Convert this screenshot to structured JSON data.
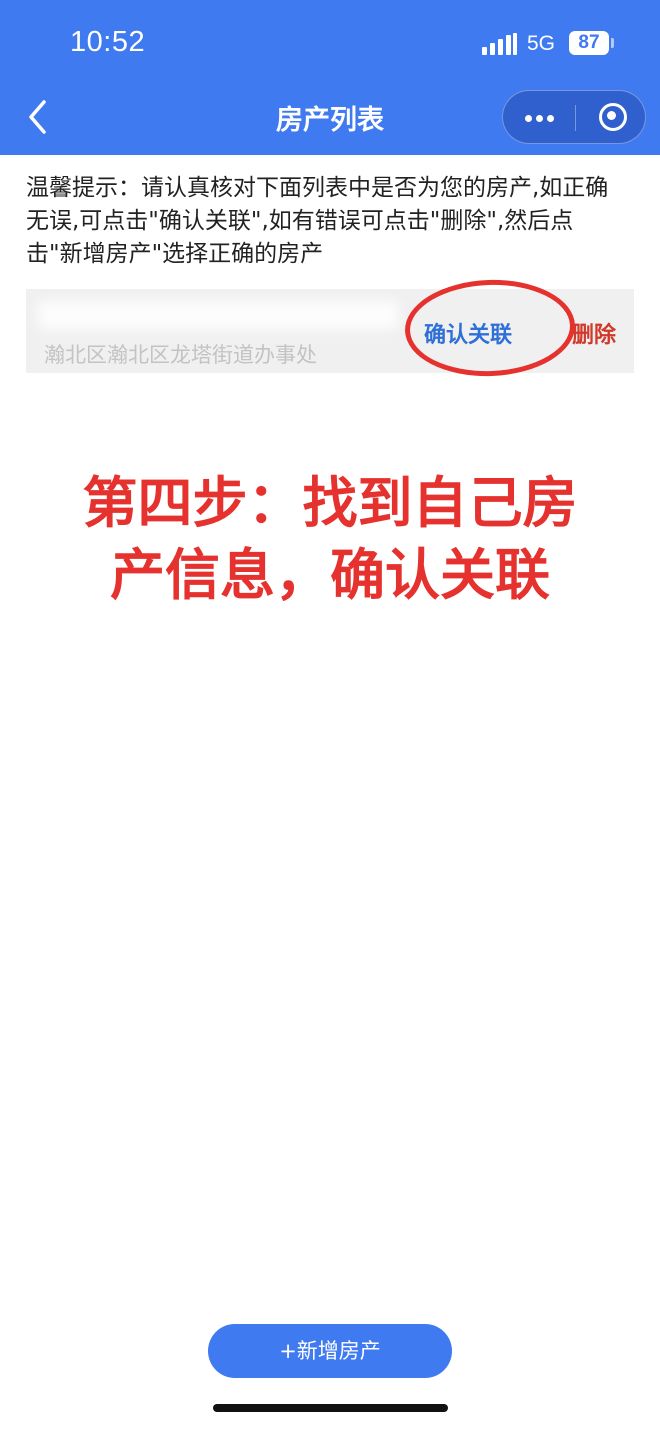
{
  "status_bar": {
    "time": "10:52",
    "network": "5G",
    "battery": "87"
  },
  "nav": {
    "title": "房产列表",
    "back_icon": "chevron-left-icon",
    "more_icon": "more-dots-icon",
    "close_icon": "target-circle-icon"
  },
  "tip": {
    "text": "温馨提示：请认真核对下面列表中是否为您的房产,如正确无误,可点击\"确认关联\",如有错误可点击\"删除\",然后点击\"新增房产\"选择正确的房产"
  },
  "property": {
    "address": "瀚北区瀚北区龙塔街道办事处",
    "confirm_label": "确认关联",
    "delete_label": "删除"
  },
  "annotation": {
    "line1": "第四步：找到自己房",
    "line2": "产信息，确认关联",
    "color": "#e5322e"
  },
  "add_button": {
    "label": "+新增房产"
  },
  "colors": {
    "primary": "#3f7af0",
    "danger": "#d03a2a",
    "link": "#2f6fd8"
  }
}
